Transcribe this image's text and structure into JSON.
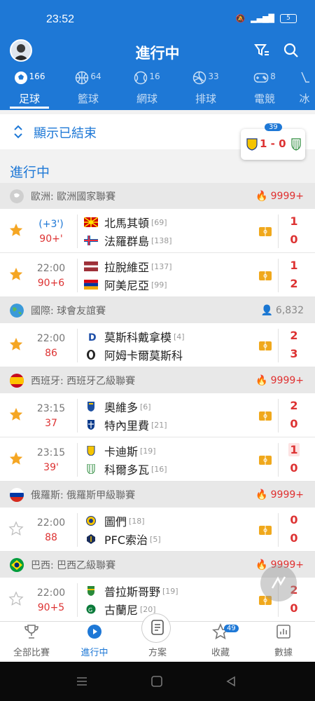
{
  "status": {
    "time": "23:52",
    "battery": "5"
  },
  "header": {
    "title": "進行中"
  },
  "tabs": [
    {
      "label": "足球",
      "count": "166"
    },
    {
      "label": "籃球",
      "count": "64"
    },
    {
      "label": "網球",
      "count": "16"
    },
    {
      "label": "排球",
      "count": "33"
    },
    {
      "label": "電競",
      "count": "8"
    },
    {
      "label": "冰",
      "count": ""
    }
  ],
  "show_ended": {
    "label": "顯示已結束"
  },
  "mini_score": {
    "badge": "39",
    "score": "1 - 0"
  },
  "section_title": "進行中",
  "leagues": [
    {
      "name": "歐洲: 歐洲國家聯賽",
      "heat": "9999+",
      "matches": [
        {
          "t1": "(+3')",
          "t2": "90+'",
          "home": "北馬其頓",
          "home_rank": "[69]",
          "away": "法羅群島",
          "away_rank": "[138]",
          "hs": "1",
          "as": "0"
        },
        {
          "t1": "22:00",
          "t2": "90+6",
          "home": "拉脫維亞",
          "home_rank": "[137]",
          "away": "阿美尼亞",
          "away_rank": "[99]",
          "hs": "1",
          "as": "2"
        }
      ]
    },
    {
      "name": "國際: 球會友誼賽",
      "heat": "6,832",
      "matches": [
        {
          "t1": "22:00",
          "t2": "86",
          "home": "莫斯科戴拿模",
          "home_rank": "[4]",
          "away": "阿姆卡爾莫斯科",
          "away_rank": "",
          "hs": "2",
          "as": "3"
        }
      ]
    },
    {
      "name": "西班牙: 西班牙乙級聯賽",
      "heat": "9999+",
      "matches": [
        {
          "t1": "23:15",
          "t2": "37",
          "home": "奧維多",
          "home_rank": "[6]",
          "away": "特內里費",
          "away_rank": "[21]",
          "hs": "2",
          "as": "0"
        },
        {
          "t1": "23:15",
          "t2": "39'",
          "home": "卡迪斯",
          "home_rank": "[19]",
          "away": "科爾多瓦",
          "away_rank": "[16]",
          "hs": "1",
          "as": "0"
        }
      ]
    },
    {
      "name": "俄羅斯: 俄羅斯甲級聯賽",
      "heat": "9999+",
      "matches": [
        {
          "t1": "22:00",
          "t2": "88",
          "home": "圖們",
          "home_rank": "[18]",
          "away": "PFC索治",
          "away_rank": "[5]",
          "hs": "0",
          "as": "0"
        }
      ]
    },
    {
      "name": "巴西: 巴西乙級聯賽",
      "heat": "9999+",
      "matches": [
        {
          "t1": "22:00",
          "t2": "90+5",
          "home": "普拉斯哥野",
          "home_rank": "[19]",
          "away": "古蘭尼",
          "away_rank": "[20]",
          "hs": "2",
          "as": "0"
        }
      ]
    }
  ],
  "bottom_nav": [
    {
      "label": "全部比賽"
    },
    {
      "label": "進行中"
    },
    {
      "label": "方案"
    },
    {
      "label": "收藏",
      "badge": "49"
    },
    {
      "label": "數據"
    }
  ],
  "colors": {
    "primary": "#1e78d6",
    "score": "#d33333",
    "star": "#f5a623"
  }
}
